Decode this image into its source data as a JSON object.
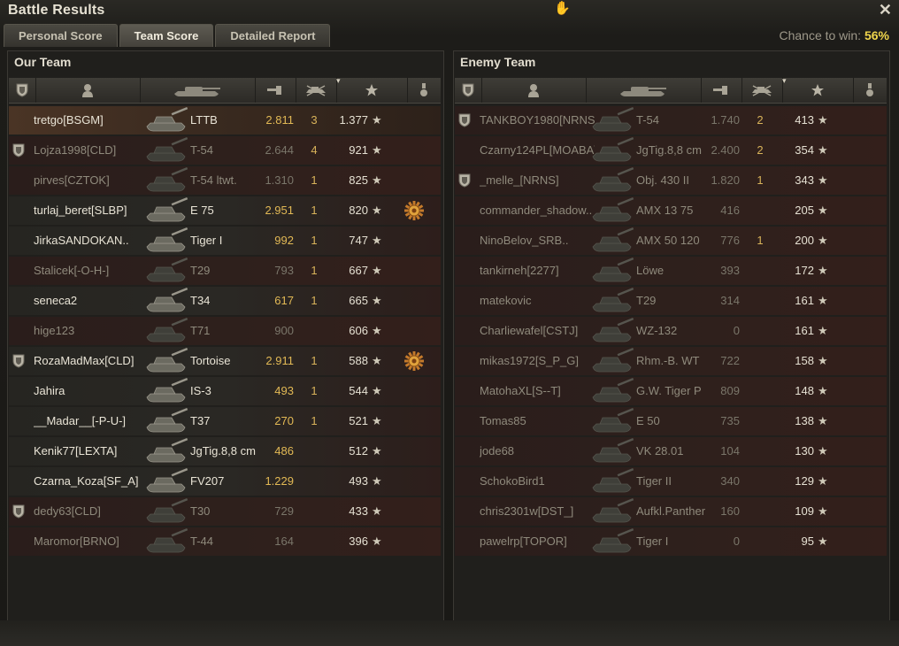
{
  "window": {
    "title": "Battle Results"
  },
  "tabs": [
    {
      "label": "Personal Score",
      "active": false
    },
    {
      "label": "Team Score",
      "active": true
    },
    {
      "label": "Detailed Report",
      "active": false
    }
  ],
  "chance": {
    "label": "Chance to win:",
    "value": "56%"
  },
  "our_team": {
    "title": "Our Team",
    "rows": [
      {
        "platoon": false,
        "name": "tretgo[BSGM]",
        "tank": "LTTB",
        "damage": "2.811",
        "kills": "3",
        "xp": "1.377",
        "medal": false,
        "alive": true,
        "player": true
      },
      {
        "platoon": true,
        "name": "Lojza1998[CLD]",
        "tank": "T-54",
        "damage": "2.644",
        "kills": "4",
        "xp": "921",
        "medal": false,
        "alive": false
      },
      {
        "platoon": false,
        "name": "pirves[CZTOK]",
        "tank": "T-54 ltwt.",
        "damage": "1.310",
        "kills": "1",
        "xp": "825",
        "medal": false,
        "alive": false
      },
      {
        "platoon": false,
        "name": "turlaj_beret[SLBP]",
        "tank": "E 75",
        "damage": "2.951",
        "kills": "1",
        "xp": "820",
        "medal": true,
        "alive": true
      },
      {
        "platoon": false,
        "name": "JirkaSANDOKAN..",
        "tank": "Tiger I",
        "damage": "992",
        "kills": "1",
        "xp": "747",
        "medal": false,
        "alive": true
      },
      {
        "platoon": false,
        "name": "Stalicek[-O-H-]",
        "tank": "T29",
        "damage": "793",
        "kills": "1",
        "xp": "667",
        "medal": false,
        "alive": false
      },
      {
        "platoon": false,
        "name": "seneca2",
        "tank": "T34",
        "damage": "617",
        "kills": "1",
        "xp": "665",
        "medal": false,
        "alive": true
      },
      {
        "platoon": false,
        "name": "hige123",
        "tank": "T71",
        "damage": "900",
        "kills": "",
        "xp": "606",
        "medal": false,
        "alive": false
      },
      {
        "platoon": true,
        "name": "RozaMadMax[CLD]",
        "tank": "Tortoise",
        "damage": "2.911",
        "kills": "1",
        "xp": "588",
        "medal": true,
        "alive": true
      },
      {
        "platoon": false,
        "name": "Jahira",
        "tank": "IS-3",
        "damage": "493",
        "kills": "1",
        "xp": "544",
        "medal": false,
        "alive": true
      },
      {
        "platoon": false,
        "name": "__Madar__[-P-U-]",
        "tank": "T37",
        "damage": "270",
        "kills": "1",
        "xp": "521",
        "medal": false,
        "alive": true
      },
      {
        "platoon": false,
        "name": "Kenik77[LEXTA]",
        "tank": "JgTig.8,8 cm",
        "damage": "486",
        "kills": "",
        "xp": "512",
        "medal": false,
        "alive": true
      },
      {
        "platoon": false,
        "name": "Czarna_Koza[SF_A]",
        "tank": "FV207",
        "damage": "1.229",
        "kills": "",
        "xp": "493",
        "medal": false,
        "alive": true
      },
      {
        "platoon": true,
        "name": "dedy63[CLD]",
        "tank": "T30",
        "damage": "729",
        "kills": "",
        "xp": "433",
        "medal": false,
        "alive": false
      },
      {
        "platoon": false,
        "name": "Maromor[BRNO]",
        "tank": "T-44",
        "damage": "164",
        "kills": "",
        "xp": "396",
        "medal": false,
        "alive": false
      }
    ]
  },
  "enemy_team": {
    "title": "Enemy Team",
    "rows": [
      {
        "platoon": true,
        "name": "TANKBOY1980[NRNS]",
        "tank": "T-54",
        "damage": "1.740",
        "kills": "2",
        "xp": "413",
        "medal": false,
        "alive": false
      },
      {
        "platoon": false,
        "name": "Czarny124PL[MOABA]",
        "tank": "JgTig.8,8 cm",
        "damage": "2.400",
        "kills": "2",
        "xp": "354",
        "medal": false,
        "alive": false
      },
      {
        "platoon": true,
        "name": "_melle_[NRNS]",
        "tank": "Obj. 430 II",
        "damage": "1.820",
        "kills": "1",
        "xp": "343",
        "medal": false,
        "alive": false
      },
      {
        "platoon": false,
        "name": "commander_shadow..",
        "tank": "AMX 13 75",
        "damage": "416",
        "kills": "",
        "xp": "205",
        "medal": false,
        "alive": false
      },
      {
        "platoon": false,
        "name": "NinoBelov_SRB..",
        "tank": "AMX 50 120",
        "damage": "776",
        "kills": "1",
        "xp": "200",
        "medal": false,
        "alive": false
      },
      {
        "platoon": false,
        "name": "tankirneh[2277]",
        "tank": "Löwe",
        "damage": "393",
        "kills": "",
        "xp": "172",
        "medal": false,
        "alive": false
      },
      {
        "platoon": false,
        "name": "matekovic",
        "tank": "T29",
        "damage": "314",
        "kills": "",
        "xp": "161",
        "medal": false,
        "alive": false
      },
      {
        "platoon": false,
        "name": "Charliewafel[CSTJ]",
        "tank": "WZ-132",
        "damage": "0",
        "kills": "",
        "xp": "161",
        "medal": false,
        "alive": false
      },
      {
        "platoon": false,
        "name": "mikas1972[S_P_G]",
        "tank": "Rhm.-B. WT",
        "damage": "722",
        "kills": "",
        "xp": "158",
        "medal": false,
        "alive": false
      },
      {
        "platoon": false,
        "name": "MatohaXL[S--T]",
        "tank": "G.W. Tiger P",
        "damage": "809",
        "kills": "",
        "xp": "148",
        "medal": false,
        "alive": false
      },
      {
        "platoon": false,
        "name": "Tomas85",
        "tank": "E 50",
        "damage": "735",
        "kills": "",
        "xp": "138",
        "medal": false,
        "alive": false
      },
      {
        "platoon": false,
        "name": "jode68",
        "tank": "VK 28.01",
        "damage": "104",
        "kills": "",
        "xp": "130",
        "medal": false,
        "alive": false
      },
      {
        "platoon": false,
        "name": "SchokoBird1",
        "tank": "Tiger II",
        "damage": "340",
        "kills": "",
        "xp": "129",
        "medal": false,
        "alive": false
      },
      {
        "platoon": false,
        "name": "chris2301w[DST_]",
        "tank": "Aufkl.Panther",
        "damage": "160",
        "kills": "",
        "xp": "109",
        "medal": false,
        "alive": false
      },
      {
        "platoon": false,
        "name": "pawelrp[TOPOR]",
        "tank": "Tiger I",
        "damage": "0",
        "kills": "",
        "xp": "95",
        "medal": false,
        "alive": false
      }
    ]
  },
  "columns": [
    "squad-icon",
    "player-icon",
    "vehicle-icon",
    "damage-icon",
    "kills-icon",
    "xp-star-icon",
    "medal-icon"
  ],
  "colors": {
    "accent": "#f0d64c",
    "alive_text": "#e9e4d6",
    "dead_text": "#8f8a7c",
    "damage_alive": "#e2b955"
  }
}
